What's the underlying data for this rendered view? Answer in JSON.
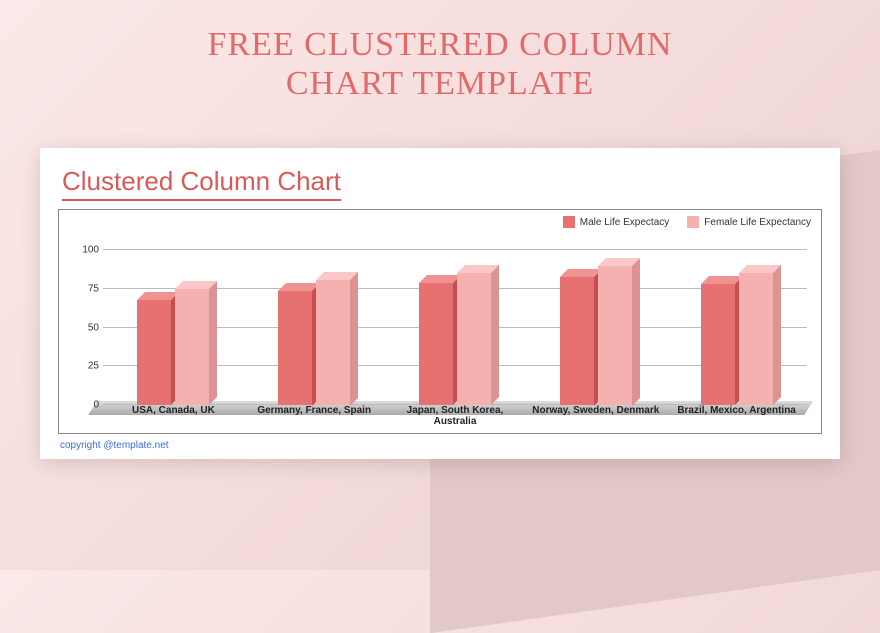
{
  "page_title_line1": "FREE CLUSTERED COLUMN",
  "page_title_line2": "CHART TEMPLATE",
  "chart_title": "Clustered Column Chart",
  "legend": {
    "male": "Male Life Expectacy",
    "female": "Female Life Expectancy"
  },
  "copyright": "copyright @template.net",
  "y_ticks": [
    "0",
    "25",
    "50",
    "75",
    "100"
  ],
  "chart_data": {
    "type": "bar",
    "title": "Clustered Column Chart",
    "categories": [
      "USA, Canada, UK",
      "Germany, France, Spain",
      "Japan, South Korea, Australia",
      "Norway, Sweden, Denmark",
      "Brazil, Mexico, Argentina"
    ],
    "series": [
      {
        "name": "Male Life Expectacy",
        "values": [
          68,
          74,
          79,
          83,
          78
        ],
        "color": "#e77070"
      },
      {
        "name": "Female Life Expectancy",
        "values": [
          75,
          81,
          85,
          90,
          85
        ],
        "color": "#f5b0b0"
      }
    ],
    "xlabel": "",
    "ylabel": "",
    "ylim": [
      0,
      100
    ]
  }
}
